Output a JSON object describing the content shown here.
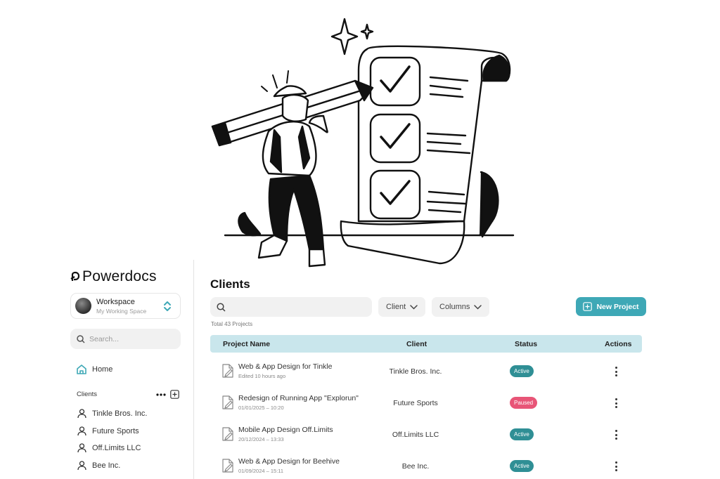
{
  "sidebar": {
    "brand": "Powerdocs",
    "workspace": {
      "name": "Workspace",
      "subtitle": "My Working Space"
    },
    "search_placeholder": "Search...",
    "home_label": "Home",
    "clients_heading": "Clients",
    "clients": [
      {
        "label": "Tinkle Bros. Inc."
      },
      {
        "label": "Future Sports"
      },
      {
        "label": "Off.Limits LLC"
      },
      {
        "label": "Bee Inc."
      }
    ]
  },
  "main": {
    "title": "Clients",
    "filters": {
      "client": "Client",
      "columns": "Columns"
    },
    "new_project_label": "New Project",
    "total": "Total 43 Projects",
    "columns": {
      "name": "Project Name",
      "client": "Client",
      "status": "Status",
      "actions": "Actions"
    },
    "rows": [
      {
        "title": "Web & App Design for Tinkle",
        "sub": "Edited 10 hours ago",
        "client": "Tinkle Bros. Inc.",
        "status": "Active"
      },
      {
        "title": "Redesign of Running App \"Explorun\"",
        "sub": "01/01/2025 – 10:20",
        "client": "Future Sports",
        "status": "Paused"
      },
      {
        "title": "Mobile App Design Off.Limits",
        "sub": "20/12/2024 – 13:33",
        "client": "Off.Limits LLC",
        "status": "Active"
      },
      {
        "title": "Web & App Design for Beehive",
        "sub": "01/09/2024 – 15:11",
        "client": "Bee Inc.",
        "status": "Active"
      }
    ]
  },
  "colors": {
    "accent": "#3ea8b6",
    "header_bg": "#c9e6ec",
    "active": "#2f8f95",
    "paused": "#e85577"
  }
}
